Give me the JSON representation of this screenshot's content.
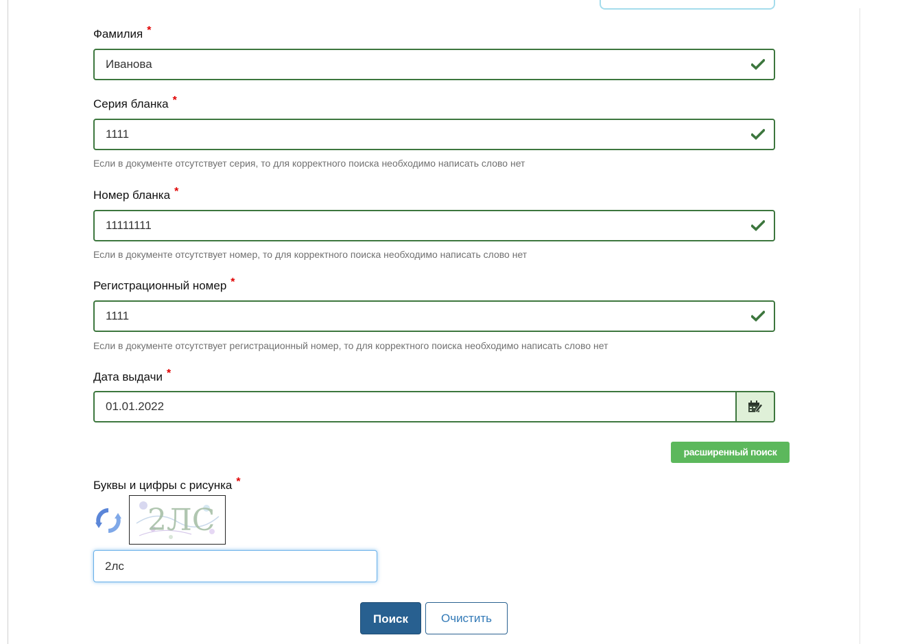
{
  "form": {
    "surname": {
      "label": "Фамилия",
      "required_mark": "*",
      "value": "Иванова"
    },
    "series": {
      "label": "Серия бланка",
      "required_mark": "*",
      "value": "1111",
      "help": "Если в документе отсутствует серия, то для корректного поиска необходимо написать слово нет"
    },
    "number": {
      "label": "Номер бланка",
      "required_mark": "*",
      "value": "11111111",
      "help": "Если в документе отсутствует номер, то для корректного поиска необходимо написать слово нет"
    },
    "reg_number": {
      "label": "Регистрационный номер",
      "required_mark": "*",
      "value": "1111",
      "help": "Если в документе отсутствует регистрационный номер, то для корректного поиска необходимо написать слово нет"
    },
    "issue_date": {
      "label": "Дата выдачи",
      "required_mark": "*",
      "value": "01.01.2022"
    },
    "advanced_search_label": "расширенный поиск",
    "captcha": {
      "label": "Буквы и цифры с рисунка",
      "required_mark": "*",
      "value": "2лс",
      "image_text": "2ЛС"
    },
    "search_label": "Поиск",
    "clear_label": "Очистить"
  },
  "colors": {
    "valid_border": "#3c763d",
    "valid_check": "#3c763d",
    "addon_bg": "#dff0d8",
    "required": "#e00000",
    "advanced_btn": "#5cb85c",
    "primary_btn": "#286090",
    "focus_border": "#66afe9"
  },
  "icons": [
    "check-icon",
    "calendar-icon",
    "refresh-icon"
  ]
}
